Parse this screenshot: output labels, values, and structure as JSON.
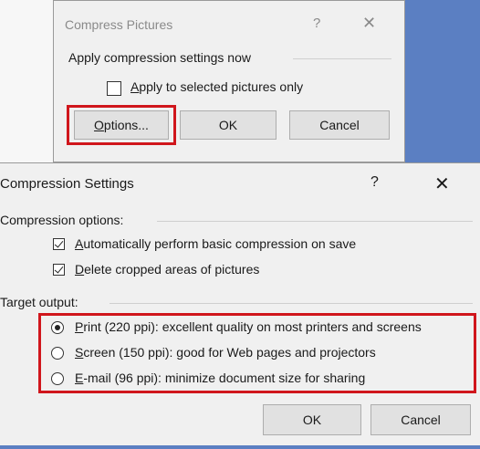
{
  "compress_dialog": {
    "title": "Compress Pictures",
    "help_glyph": "?",
    "close_glyph": "✕",
    "group_label": "Apply compression settings now",
    "checkbox_label_prefix": "",
    "checkbox_label_mnemonic": "A",
    "checkbox_label_rest": "pply to selected pictures only",
    "options_mnemonic": "O",
    "options_rest": "ptions...",
    "ok_label": "OK",
    "cancel_label": "Cancel"
  },
  "settings_dialog": {
    "title": "Compression Settings",
    "help_glyph": "?",
    "close_glyph": "✕",
    "compression_options_label": "Compression options:",
    "auto_compress": {
      "mnemonic": "A",
      "rest": "utomatically perform basic compression on save",
      "checked": true
    },
    "delete_cropped": {
      "mnemonic": "D",
      "rest": "elete cropped areas of pictures",
      "checked": true
    },
    "target_output_label": "Target output:",
    "targets": [
      {
        "mnemonic": "P",
        "rest": "rint (220 ppi): excellent quality on most printers and screens",
        "selected": true
      },
      {
        "mnemonic": "S",
        "rest": "creen (150 ppi): good for Web pages and projectors",
        "selected": false
      },
      {
        "mnemonic": "E",
        "rest": "-mail (96 ppi): minimize document size for sharing",
        "selected": false
      }
    ],
    "ok_label": "OK",
    "cancel_label": "Cancel"
  },
  "accent_colors": {
    "highlight": "#d0161c",
    "window_bg": "#f0f0f0",
    "desktop": "#5b7fc2"
  }
}
